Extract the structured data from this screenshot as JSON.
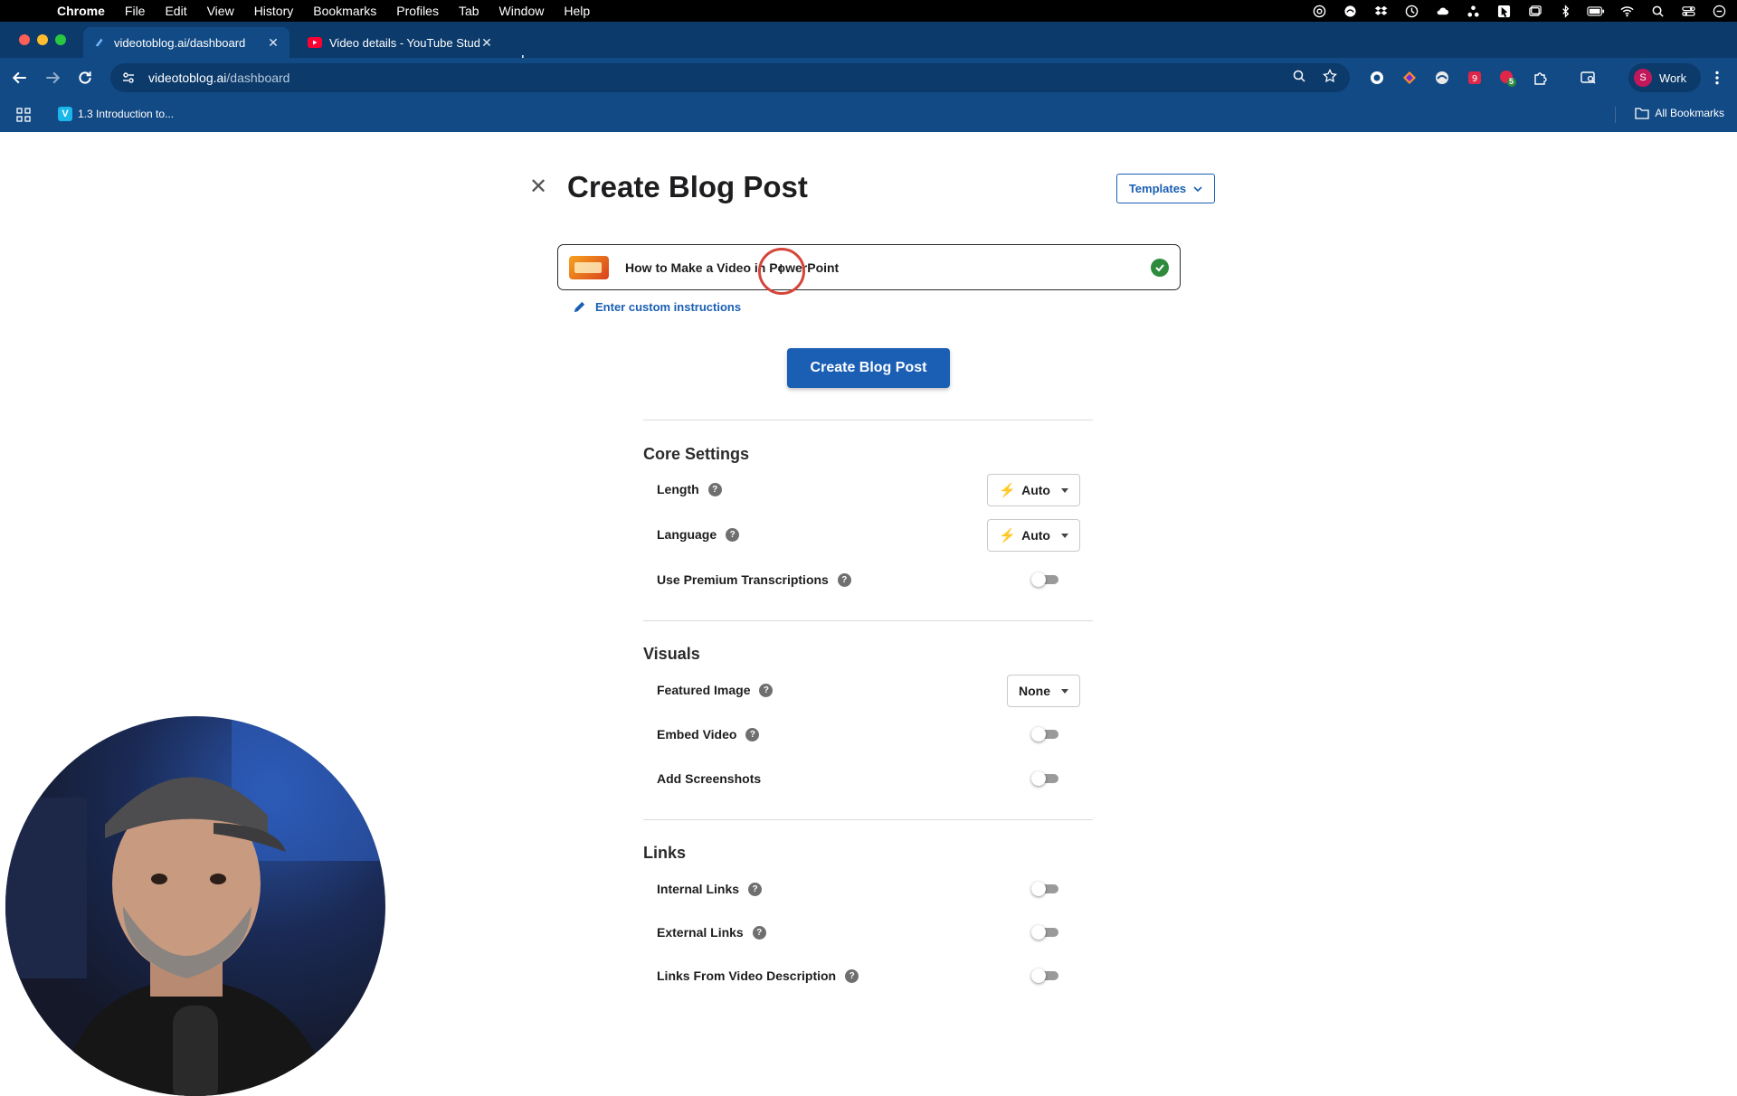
{
  "menubar": {
    "app": "Chrome",
    "items": [
      "File",
      "Edit",
      "View",
      "History",
      "Bookmarks",
      "Profiles",
      "Tab",
      "Window",
      "Help"
    ]
  },
  "tabs": [
    {
      "label": "videotoblog.ai/dashboard",
      "icon": "videotoblog-favicon",
      "active": true
    },
    {
      "label": "Video details - YouTube Studi",
      "icon": "youtube-favicon",
      "active": false
    }
  ],
  "toolbar": {
    "url_host": "videotoblog.ai",
    "url_path": "/dashboard",
    "profile_initial": "S",
    "profile_label": "Work",
    "extension_badge": "5"
  },
  "bookmarks": {
    "item1": "1.3 Introduction to...",
    "all": "All Bookmarks"
  },
  "page": {
    "title": "Create Blog Post",
    "templates_label": "Templates",
    "video_title": "How to Make a Video in PowerPoint",
    "custom_instructions": "Enter custom instructions",
    "create_button": "Create Blog Post",
    "help_glyph": "?",
    "core": {
      "title": "Core Settings",
      "length_label": "Length",
      "length_value": "Auto",
      "language_label": "Language",
      "language_value": "Auto",
      "premium_label": "Use Premium Transcriptions"
    },
    "visuals": {
      "title": "Visuals",
      "featured_label": "Featured Image",
      "featured_value": "None",
      "embed_label": "Embed Video",
      "screenshots_label": "Add Screenshots"
    },
    "links": {
      "title": "Links",
      "internal_label": "Internal Links",
      "external_label": "External Links",
      "description_label": "Links From Video Description"
    }
  },
  "colors": {
    "accent": "#1a5fb4",
    "chrome_frame": "#0b3a6b",
    "chrome_toolbar": "#124a85",
    "success": "#2e8b3d"
  }
}
